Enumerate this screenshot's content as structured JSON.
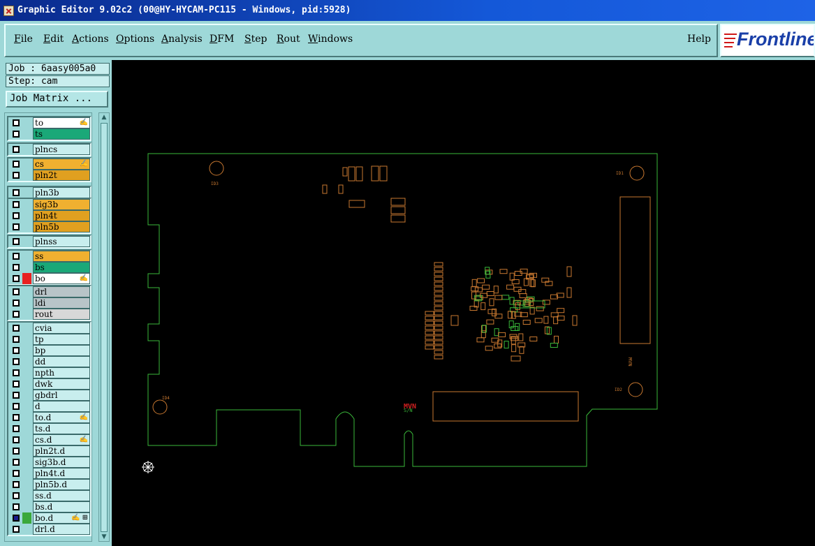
{
  "window": {
    "title": "Graphic Editor 9.02c2 (00@HY-HYCAM-PC115 - Windows, pid:5928)"
  },
  "menu": {
    "items": [
      "File",
      "Edit",
      "Actions",
      "Options",
      "Analysis",
      "DFM",
      "Step",
      "Rout",
      "Windows"
    ],
    "help": "Help"
  },
  "logo": {
    "text": "Frontline"
  },
  "job": {
    "label": "Job : 6aasy005a0",
    "step": "Step: cam"
  },
  "job_matrix_button": "Job Matrix ...",
  "colors": {
    "panel": "#9ed8d8",
    "board_outline": "#3ab83a",
    "pad": "#c87830",
    "canvas": "#000000"
  },
  "layers": [
    {
      "name": "to",
      "color": "#ffffff",
      "mark": "✍",
      "group": 0
    },
    {
      "name": "ts",
      "color": "#1aa878",
      "mark": "",
      "group": 0
    },
    {
      "name": "plncs",
      "color": "#c8eeee",
      "mark": "",
      "group": 1
    },
    {
      "name": "cs",
      "color": "#f0b030",
      "mark": "✍",
      "group": 2
    },
    {
      "name": "pln2t",
      "color": "#e0a020",
      "mark": "",
      "group": 2
    },
    {
      "name": "pln3b",
      "color": "#c8eeee",
      "mark": "",
      "group": 3
    },
    {
      "name": "sig3b",
      "color": "#f0b030",
      "mark": "",
      "group": 4
    },
    {
      "name": "pln4t",
      "color": "#e0a020",
      "mark": "",
      "group": 4
    },
    {
      "name": "pln5b",
      "color": "#e0a020",
      "mark": "",
      "group": 4
    },
    {
      "name": "plnss",
      "color": "#c8eeee",
      "mark": "",
      "group": 5
    },
    {
      "name": "ss",
      "color": "#f0b030",
      "mark": "",
      "group": 6
    },
    {
      "name": "bs",
      "color": "#1aa878",
      "mark": "",
      "group": 6
    },
    {
      "name": "bo",
      "color": "#ffffff",
      "mark": "✍",
      "group": 6
    },
    {
      "name": "drl",
      "color": "#b8c4c8",
      "mark": "",
      "group": 7
    },
    {
      "name": "ldi",
      "color": "#b8c4c8",
      "mark": "",
      "group": 7
    },
    {
      "name": "rout",
      "color": "#d8d8d8",
      "mark": "",
      "group": 7
    },
    {
      "name": "cvia",
      "color": "#c8eeee",
      "mark": "",
      "group": 8
    },
    {
      "name": "tp",
      "color": "#c8eeee",
      "mark": "",
      "group": 8
    },
    {
      "name": "bp",
      "color": "#c8eeee",
      "mark": "",
      "group": 8
    },
    {
      "name": "dd",
      "color": "#c8eeee",
      "mark": "",
      "group": 8
    },
    {
      "name": "npth",
      "color": "#c8eeee",
      "mark": "",
      "group": 8
    },
    {
      "name": "dwk",
      "color": "#c8eeee",
      "mark": "",
      "group": 8
    },
    {
      "name": "gbdrl",
      "color": "#c8eeee",
      "mark": "",
      "group": 8
    },
    {
      "name": "d",
      "color": "#c8eeee",
      "mark": "",
      "group": 8
    },
    {
      "name": "to.d",
      "color": "#c8eeee",
      "mark": "✍",
      "group": 8
    },
    {
      "name": "ts.d",
      "color": "#c8eeee",
      "mark": "",
      "group": 8
    },
    {
      "name": "cs.d",
      "color": "#c8eeee",
      "mark": "✍",
      "group": 8
    },
    {
      "name": "pln2t.d",
      "color": "#c8eeee",
      "mark": "",
      "group": 8
    },
    {
      "name": "sig3b.d",
      "color": "#c8eeee",
      "mark": "",
      "group": 8
    },
    {
      "name": "pln4t.d",
      "color": "#c8eeee",
      "mark": "",
      "group": 8
    },
    {
      "name": "pln5b.d",
      "color": "#c8eeee",
      "mark": "",
      "group": 8
    },
    {
      "name": "ss.d",
      "color": "#c8eeee",
      "mark": "",
      "group": 8
    },
    {
      "name": "bs.d",
      "color": "#c8eeee",
      "mark": "",
      "group": 8
    },
    {
      "name": "bo.d",
      "color": "#c8eeee",
      "mark": "✍ ⊞",
      "group": 8
    },
    {
      "name": "drl.d",
      "color": "#c8eeee",
      "mark": "",
      "group": 8
    }
  ],
  "layer_state": {
    "bo": {
      "swatch": "#e82020"
    },
    "bo.d": {
      "checked": true,
      "swatch": "#3aa83a"
    }
  },
  "board_labels": {
    "tl_hole": "ID3",
    "tr_hole": "ID1",
    "bl_hole": "ID4",
    "br_hole": "ID2"
  }
}
